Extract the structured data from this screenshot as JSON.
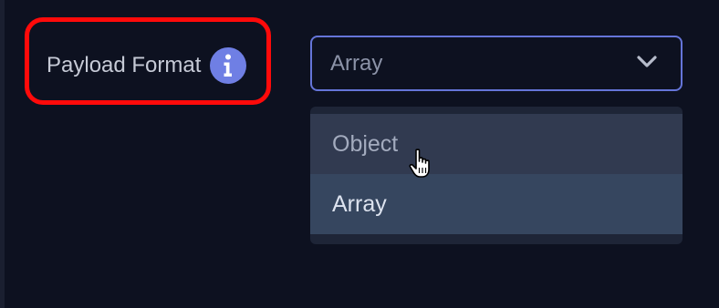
{
  "field": {
    "label": "Payload Format",
    "info_icon": "info-icon"
  },
  "select": {
    "value": "Array",
    "chevron_icon": "chevron-down-icon"
  },
  "menu": {
    "options": [
      "Object",
      "Array"
    ],
    "hovered": "Object",
    "selected": "Array"
  },
  "colors": {
    "background": "#0d1120",
    "highlight_border": "#ff0a0a",
    "accent": "#6f7fe4",
    "select_border": "#6575d9"
  },
  "cursor": "pointer-hand-icon"
}
